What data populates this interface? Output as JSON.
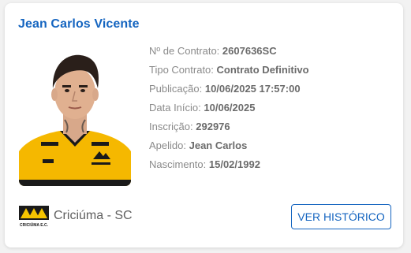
{
  "player": {
    "name": "Jean Carlos Vicente",
    "photo_icon": "player-photo"
  },
  "contract": [
    {
      "label": "Nº de Contrato:",
      "value": "2607636SC"
    },
    {
      "label": "Tipo Contrato:",
      "value": "Contrato Definitivo"
    },
    {
      "label": "Publicação:",
      "value": "10/06/2025 17:57:00"
    },
    {
      "label": "Data Início:",
      "value": "10/06/2025"
    },
    {
      "label": "Inscrição:",
      "value": "292976"
    },
    {
      "label": "Apelido:",
      "value": "Jean Carlos"
    },
    {
      "label": "Nascimento:",
      "value": "15/02/1992"
    }
  ],
  "club": {
    "name": "Criciúma - SC",
    "logo_icon": "criciuma-crest-icon",
    "logo_text": "CRICIÚMA E.C."
  },
  "actions": {
    "history_label": "VER HISTÓRICO"
  },
  "colors": {
    "accent": "#1565c0",
    "jersey_yellow": "#f5b800",
    "label_gray": "#8a8a8a"
  }
}
